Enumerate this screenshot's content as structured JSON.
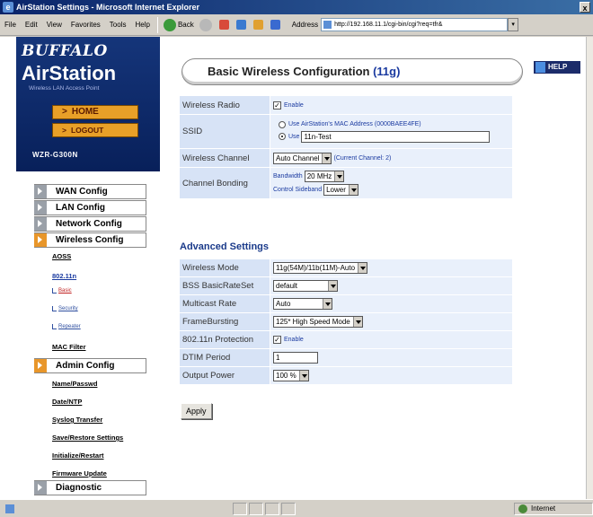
{
  "window": {
    "title": "AirStation Settings - Microsoft Internet Explorer",
    "close_glyph": "x"
  },
  "menubar": {
    "items": [
      "File",
      "Edit",
      "View",
      "Favorites",
      "Tools",
      "Help"
    ],
    "back_label": "Back",
    "address_label": "Address",
    "address_value": "http://192.168.11.1/cgi-bin/cgi?req=tfr&"
  },
  "sidebar": {
    "brand": "BUFFALO",
    "product": "AirStation",
    "tagline": "Wireless LAN Access Point",
    "home": "HOME",
    "logout": "LOGOUT",
    "model": "WZR-G300N",
    "menu": {
      "wan": "WAN Config",
      "lan": "LAN Config",
      "network": "Network Config",
      "wireless": "Wireless Config",
      "admin": "Admin Config",
      "diagnostic": "Diagnostic"
    },
    "wireless_links": {
      "aoss": "AOSS",
      "n80211": "802.11n",
      "basic": "Basic",
      "security": "Security",
      "repeater": "Repeater",
      "mac_filter": "MAC Filter"
    },
    "admin_links": {
      "name_passwd": "Name/Passwd",
      "date_ntp": "Date/NTP",
      "syslog": "Syslog Transfer",
      "save_restore": "Save/Restore Settings",
      "init_restart": "Initialize/Restart",
      "firmware": "Firmware Update"
    }
  },
  "main": {
    "title": "Basic Wireless Configuration ",
    "title_accent": "(11g)",
    "help": "HELP",
    "rows": {
      "radio_label": "Wireless Radio",
      "radio_value": "Enable",
      "ssid_label": "SSID",
      "ssid_option1": "Use AirStation's MAC Address (0000BAEE4FE)",
      "ssid_option2": "Use",
      "ssid_value": "11n-Test",
      "channel_label": "Wireless Channel",
      "channel_value": "Auto Channel",
      "channel_current": "(Current Channel: 2)",
      "bonding_label": "Channel Bonding",
      "bandwidth_label": "Bandwidth",
      "bandwidth_value": "20 MHz",
      "sideband_label": "Control Sideband",
      "sideband_value": "Lower"
    },
    "advanced_title": "Advanced Settings",
    "advanced": {
      "mode_label": "Wireless Mode",
      "mode_value": "11g(54M)/11b(11M)-Auto",
      "bss_label": "BSS BasicRateSet",
      "bss_value": "default",
      "multicast_label": "Multicast Rate",
      "multicast_value": "Auto",
      "frameburst_label": "FrameBursting",
      "frameburst_value": "125* High Speed Mode",
      "protection_label": "802.11n Protection",
      "protection_value": "Enable",
      "dtim_label": "DTIM Period",
      "dtim_value": "1",
      "power_label": "Output Power",
      "power_value": "100 %"
    },
    "apply": "Apply"
  },
  "status": {
    "zone": "Internet"
  }
}
